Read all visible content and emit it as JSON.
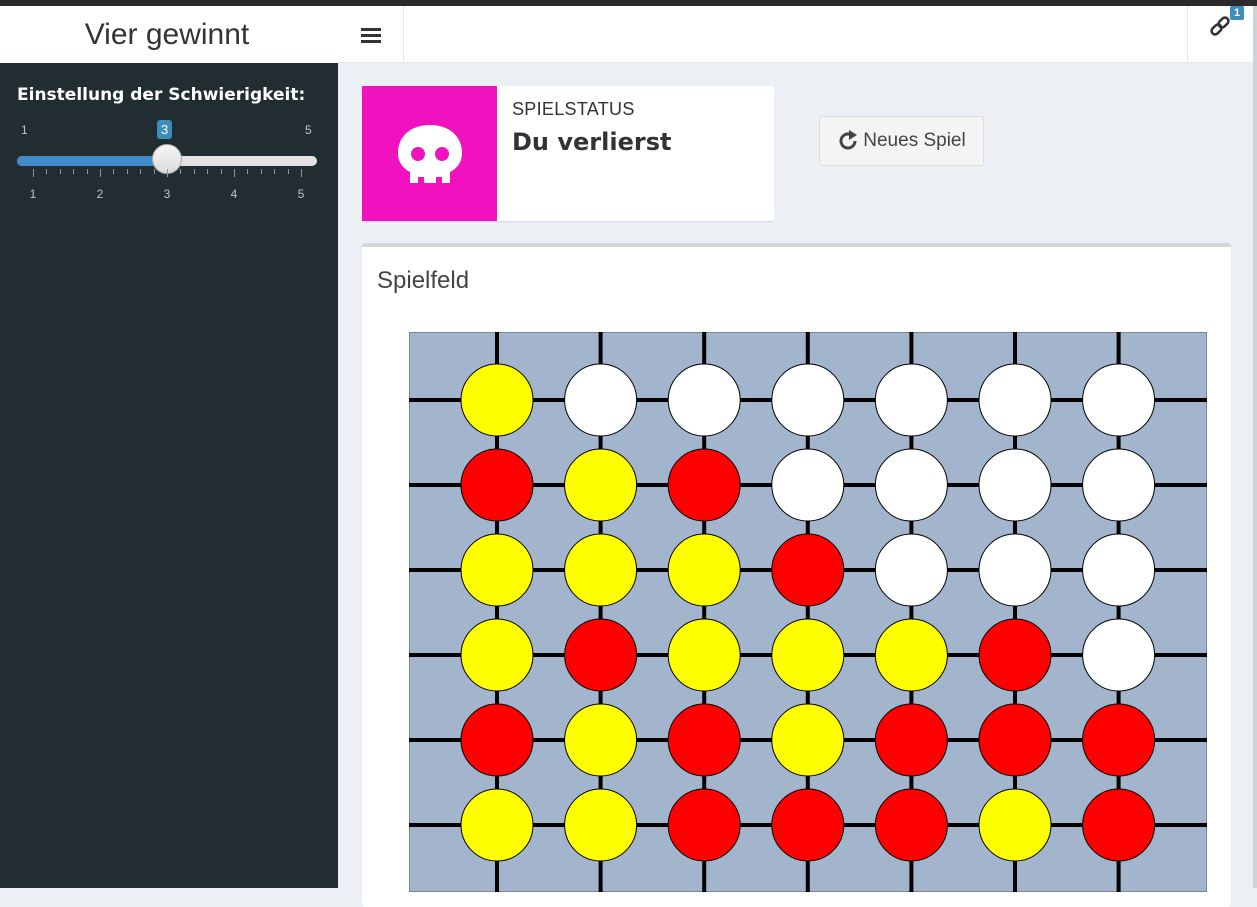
{
  "header": {
    "app_title": "Vier gewinnt",
    "menu_icon": "bars-icon",
    "link_icon": "link-icon",
    "link_badge": "1"
  },
  "sidebar": {
    "slider": {
      "label": "Einstellung der Schwierigkeit:",
      "min": 1,
      "max": 5,
      "value": 3,
      "min_label": "1",
      "max_label": "5",
      "value_label": "3",
      "tick_labels": [
        "1",
        "2",
        "3",
        "4",
        "5"
      ]
    }
  },
  "status": {
    "caption": "SPIELSTATUS",
    "value": "Du verlierst",
    "icon": "skull-icon",
    "color": "#f012be"
  },
  "new_game_button": {
    "label": "Neues Spiel",
    "icon": "refresh-icon"
  },
  "board_panel": {
    "title": "Spielfeld",
    "colors": {
      "board": "#a2b5cd",
      "yellow": "#ffff00",
      "red": "#ff0000",
      "empty": "#ffffff",
      "grid": "#000000"
    },
    "rows": [
      [
        "yellow",
        "empty",
        "empty",
        "empty",
        "empty",
        "empty",
        "empty"
      ],
      [
        "red",
        "yellow",
        "red",
        "empty",
        "empty",
        "empty",
        "empty"
      ],
      [
        "yellow",
        "yellow",
        "yellow",
        "red",
        "empty",
        "empty",
        "empty"
      ],
      [
        "yellow",
        "red",
        "yellow",
        "yellow",
        "yellow",
        "red",
        "empty"
      ],
      [
        "red",
        "yellow",
        "red",
        "yellow",
        "red",
        "red",
        "red"
      ],
      [
        "yellow",
        "yellow",
        "red",
        "red",
        "red",
        "yellow",
        "red"
      ]
    ]
  }
}
